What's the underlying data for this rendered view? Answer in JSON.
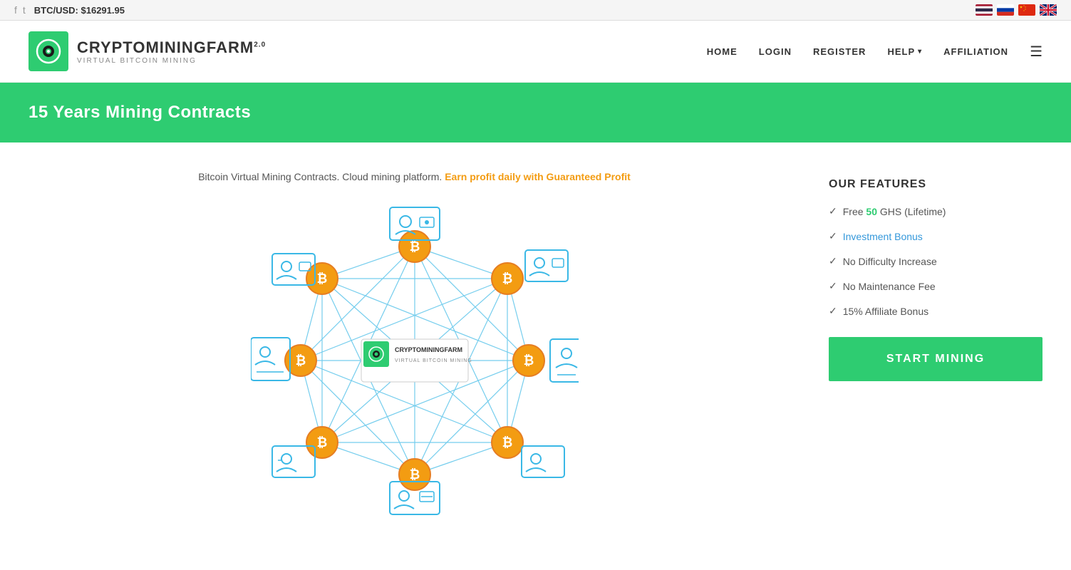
{
  "topbar": {
    "btc_label": "BTC/USD:",
    "btc_price": "$16291.95",
    "social": [
      "f",
      "t"
    ]
  },
  "header": {
    "logo_name": "CRYPTOMININGFARM",
    "logo_sup": "2.0",
    "logo_sub": "VIRTUAL BITCOIN MINING",
    "nav": [
      {
        "label": "HOME",
        "id": "home"
      },
      {
        "label": "LOGIN",
        "id": "login"
      },
      {
        "label": "REGISTER",
        "id": "register"
      },
      {
        "label": "HELP",
        "id": "help",
        "has_dropdown": true
      },
      {
        "label": "AFFILIATION",
        "id": "affiliation"
      }
    ]
  },
  "hero": {
    "title": "15 Years Mining Contracts"
  },
  "main": {
    "tagline": "Bitcoin Virtual Mining Contracts. Cloud mining platform. Earn profit daily with Guaranteed Profit",
    "tagline_highlight": "Earn profit daily with Guaranteed Profit"
  },
  "features": {
    "title": "OUR FEATURES",
    "items": [
      {
        "text_prefix": "Free ",
        "highlight": "50",
        "text_suffix": " GHS (Lifetime)"
      },
      {
        "text": "Investment Bonus",
        "is_link": true
      },
      {
        "text": "No Difficulty Increase"
      },
      {
        "text": "No Maintenance Fee"
      },
      {
        "text": "15% Affiliate Bonus"
      }
    ]
  },
  "cta": {
    "label": "START MINING"
  }
}
